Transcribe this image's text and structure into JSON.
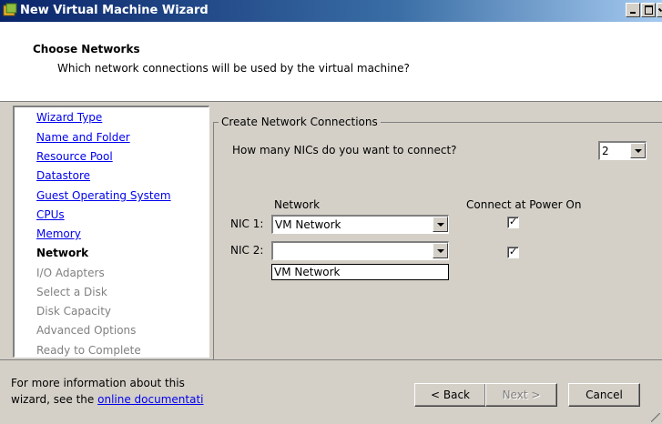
{
  "window": {
    "title": "New Virtual Machine Wizard"
  },
  "header": {
    "title": "Choose Networks",
    "subtitle": "Which network connections will be used by the virtual machine?"
  },
  "nav": {
    "items": [
      {
        "label": "Wizard Type",
        "state": "link"
      },
      {
        "label": "Name and Folder",
        "state": "link"
      },
      {
        "label": "Resource Pool",
        "state": "link"
      },
      {
        "label": "Datastore",
        "state": "link"
      },
      {
        "label": "Guest Operating System",
        "state": "link"
      },
      {
        "label": "CPUs",
        "state": "link"
      },
      {
        "label": "Memory",
        "state": "link"
      },
      {
        "label": "Network",
        "state": "current"
      },
      {
        "label": "I/O Adapters",
        "state": "disabled"
      },
      {
        "label": "Select a Disk",
        "state": "disabled"
      },
      {
        "label": "Disk Capacity",
        "state": "disabled"
      },
      {
        "label": "Advanced Options",
        "state": "disabled"
      },
      {
        "label": "Ready to Complete",
        "state": "disabled"
      }
    ]
  },
  "main": {
    "group_title": "Create Network Connections",
    "nic_question": "How many NICs do you want to connect?",
    "nic_count": "2",
    "col_network": "Network",
    "col_connect": "Connect at Power On",
    "nics": [
      {
        "label": "NIC 1:",
        "network": "VM Network",
        "connect": true
      },
      {
        "label": "NIC 2:",
        "network": "",
        "connect": true
      }
    ],
    "open_dropdown_option": "VM Network"
  },
  "footer": {
    "info_line1": "For more information about this",
    "info_line2_prefix": "wizard, see the",
    "info_link": "online documentati",
    "back_label": "< Back",
    "next_label": "Next >",
    "cancel_label": "Cancel"
  },
  "colors": {
    "titlebar_start": "#0a246a",
    "dialog_face": "#d4d0c8",
    "link": "#0000ee",
    "disabled_text": "#808080"
  }
}
